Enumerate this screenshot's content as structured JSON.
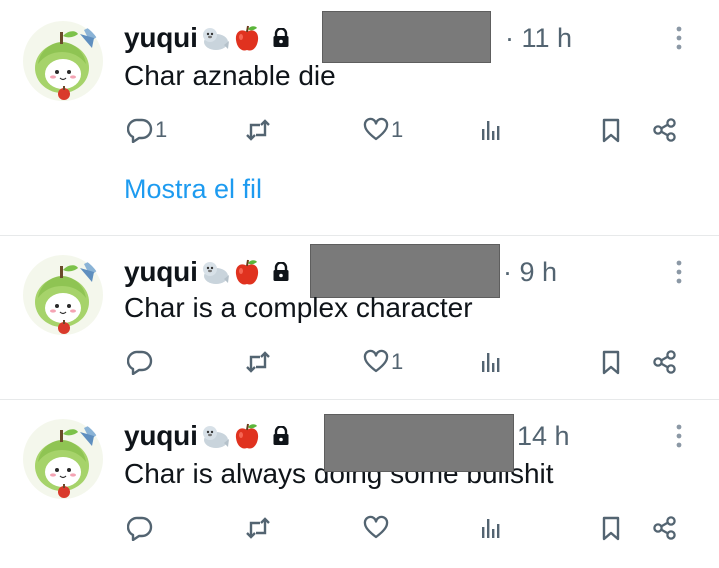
{
  "tweets": [
    {
      "author": "yuqui",
      "time": "· 11 h",
      "time_prefix": ":",
      "text": "Char aznable die",
      "replies": "1",
      "likes": "1",
      "show_thread": "Mostra el fil"
    },
    {
      "author": "yuqui",
      "time": "· 9 h",
      "text": "Char is a complex character",
      "replies": "",
      "likes": "1"
    },
    {
      "author": "yuqui",
      "time": "14 h",
      "text": "Char is always doing some bullshit",
      "replies": "",
      "likes": ""
    }
  ],
  "icons": {
    "emoji_1": "seal-emoji",
    "emoji_2": "apple-emoji",
    "lock": "lock-icon",
    "reply": "reply-icon",
    "retweet": "retweet-icon",
    "like": "heart-icon",
    "views": "views-icon",
    "bookmark": "bookmark-icon",
    "share": "share-icon",
    "more": "more-vertical-icon"
  },
  "colors": {
    "text": "#0f1419",
    "secondary": "#536471",
    "link": "#1d9bf0",
    "redaction": "#7a7a7a"
  }
}
